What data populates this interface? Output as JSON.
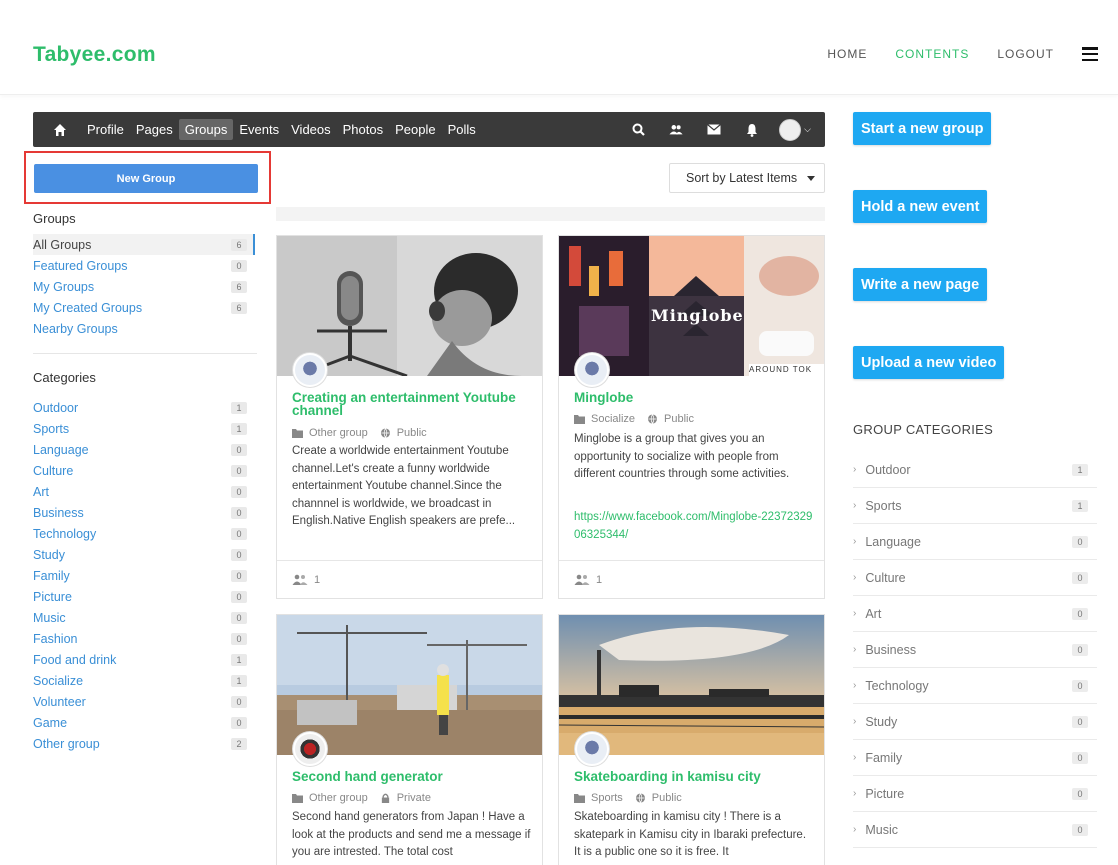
{
  "site": {
    "logo": "Tabyee.com",
    "nav": [
      "HOME",
      "CONTENTS",
      "LOGOUT"
    ]
  },
  "toolbar": {
    "links": [
      "Profile",
      "Pages",
      "Groups",
      "Events",
      "Videos",
      "Photos",
      "People",
      "Polls"
    ],
    "active": "Groups"
  },
  "sidebar": {
    "new_group_label": "New Group",
    "groups_heading": "Groups",
    "groups": [
      {
        "label": "All Groups",
        "count": "6"
      },
      {
        "label": "Featured Groups",
        "count": "0"
      },
      {
        "label": "My Groups",
        "count": "6"
      },
      {
        "label": "My Created Groups",
        "count": "6"
      },
      {
        "label": "Nearby Groups",
        "count": ""
      }
    ],
    "categories_heading": "Categories",
    "categories": [
      {
        "label": "Outdoor",
        "count": "1"
      },
      {
        "label": "Sports",
        "count": "1"
      },
      {
        "label": "Language",
        "count": "0"
      },
      {
        "label": "Culture",
        "count": "0"
      },
      {
        "label": "Art",
        "count": "0"
      },
      {
        "label": "Business",
        "count": "0"
      },
      {
        "label": "Technology",
        "count": "0"
      },
      {
        "label": "Study",
        "count": "0"
      },
      {
        "label": "Family",
        "count": "0"
      },
      {
        "label": "Picture",
        "count": "0"
      },
      {
        "label": "Music",
        "count": "0"
      },
      {
        "label": "Fashion",
        "count": "0"
      },
      {
        "label": "Food and drink",
        "count": "1"
      },
      {
        "label": "Socialize",
        "count": "1"
      },
      {
        "label": "Volunteer",
        "count": "0"
      },
      {
        "label": "Game",
        "count": "0"
      },
      {
        "label": "Other group",
        "count": "2"
      }
    ]
  },
  "sort": {
    "label": "Sort by Latest Items"
  },
  "cards": [
    {
      "title": "Creating an entertainment Youtube channel",
      "category": "Other group",
      "privacy": "Public",
      "description": "Create a worldwide entertainment Youtube channel.Let's create a funny worldwide entertainment Youtube channel.Since the channnel is worldwide, we broadcast in English.Native English speakers are prefe...",
      "link": "",
      "members": "1"
    },
    {
      "title": "Minglobe",
      "category": "Socialize",
      "privacy": "Public",
      "description": "Minglobe is a group that gives you an opportunity to socialize with people from different countries through some activities.",
      "link": "https://www.facebook.com/Minglobe-2237232906325344/",
      "members": "1",
      "photo_text": "Minglobe",
      "photo_caption": "AROUND TOK"
    },
    {
      "title": "Second hand generator",
      "category": "Other group",
      "privacy": "Private",
      "description": "Second hand generators from Japan ! Have a look at the products and send me a message if you are intrested. The total cost"
    },
    {
      "title": "Skateboarding in kamisu city",
      "category": "Sports",
      "privacy": "Public",
      "description": "Skateboarding in kamisu city ! There is a skatepark in Kamisu city in Ibaraki prefecture. It is a public one so it is free. It"
    }
  ],
  "right": {
    "buttons": [
      "Start a new group",
      "Hold a new event",
      "Write a new page",
      "Upload a new video"
    ],
    "heading": "GROUP CATEGORIES",
    "categories": [
      {
        "label": "Outdoor",
        "count": "1"
      },
      {
        "label": "Sports",
        "count": "1"
      },
      {
        "label": "Language",
        "count": "0"
      },
      {
        "label": "Culture",
        "count": "0"
      },
      {
        "label": "Art",
        "count": "0"
      },
      {
        "label": "Business",
        "count": "0"
      },
      {
        "label": "Technology",
        "count": "0"
      },
      {
        "label": "Study",
        "count": "0"
      },
      {
        "label": "Family",
        "count": "0"
      },
      {
        "label": "Picture",
        "count": "0"
      },
      {
        "label": "Music",
        "count": "0"
      }
    ]
  },
  "colors": {
    "brand": "#2ebd6b",
    "primary": "#4a90e2",
    "cta": "#1ea8f2",
    "toolbar": "#3a3a3a",
    "link": "#3a8fd6",
    "highlight": "#e53935"
  }
}
